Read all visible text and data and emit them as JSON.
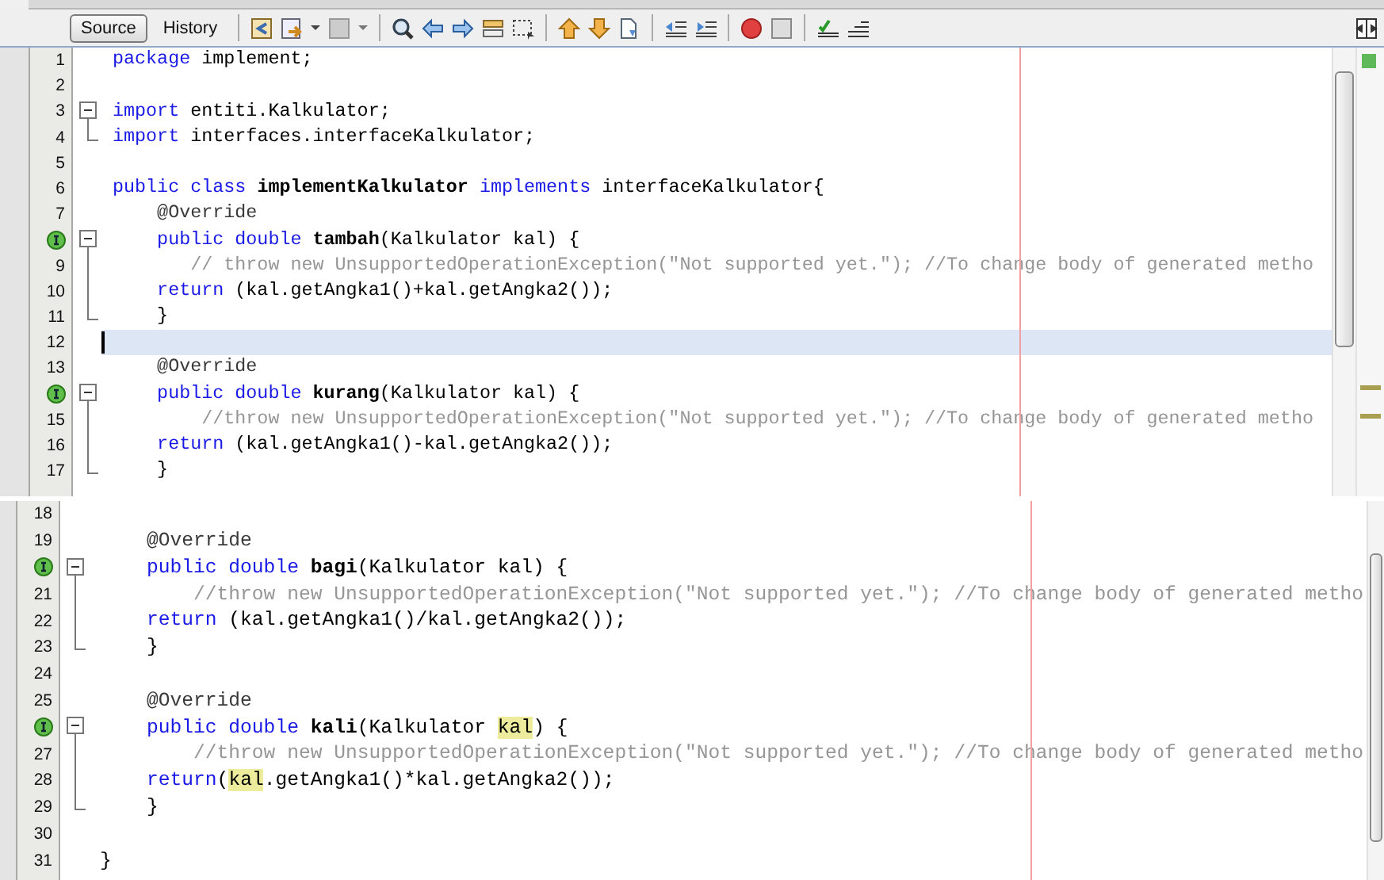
{
  "toolbar": {
    "tabs": [
      {
        "label": "Source",
        "selected": true
      },
      {
        "label": "History",
        "selected": false
      }
    ]
  },
  "editors": [
    {
      "lines": [
        {
          "number": "1",
          "overrides": false,
          "kind": "plain",
          "current": false,
          "tokens": [
            {
              "kind": "keyword",
              "text": "package"
            },
            {
              "kind": "plain",
              "text": " implement;"
            }
          ]
        },
        {
          "number": "2",
          "overrides": false,
          "kind": "plain",
          "current": false
        },
        {
          "number": "3",
          "overrides": false,
          "kind": "open",
          "current": false,
          "tokens": [
            {
              "kind": "keyword",
              "text": "import"
            },
            {
              "kind": "plain",
              "text": " entiti.Kalkulator;"
            }
          ]
        },
        {
          "number": "4",
          "overrides": false,
          "kind": "close",
          "current": false,
          "tokens": [
            {
              "kind": "keyword",
              "text": "import"
            },
            {
              "kind": "plain",
              "text": " interfaces.interfaceKalkulator;"
            }
          ]
        },
        {
          "number": "5",
          "overrides": false,
          "kind": "plain",
          "current": false
        },
        {
          "number": "6",
          "overrides": false,
          "kind": "plain",
          "current": false,
          "tokens": [
            {
              "kind": "keyword",
              "text": "public class "
            },
            {
              "kind": "bold",
              "text": "implementKalkulator"
            },
            {
              "kind": "keyword",
              "text": " implements"
            },
            {
              "kind": "plain",
              "text": " interfaceKalkulator{"
            }
          ]
        },
        {
          "number": "7",
          "overrides": false,
          "kind": "plain",
          "current": false,
          "tokens": [
            {
              "kind": "annotation",
              "text": "    @Override"
            }
          ]
        },
        {
          "overrides": true,
          "kind": "open",
          "current": false,
          "tokens": [
            {
              "kind": "keyword",
              "text": "    public double "
            },
            {
              "kind": "bold",
              "text": "tambah"
            },
            {
              "kind": "plain",
              "text": "(Kalkulator kal) {"
            }
          ]
        },
        {
          "number": "9",
          "overrides": false,
          "kind": "body",
          "current": false,
          "tokens": [
            {
              "kind": "comment",
              "text": "       // throw new UnsupportedOperationException(\"Not supported yet.\"); //To change body of generated metho"
            }
          ]
        },
        {
          "number": "10",
          "overrides": false,
          "kind": "body",
          "current": false,
          "tokens": [
            {
              "kind": "keyword",
              "text": "    return"
            },
            {
              "kind": "plain",
              "text": " (kal.getAngka1()+kal.getAngka2());"
            }
          ]
        },
        {
          "number": "11",
          "overrides": false,
          "kind": "close",
          "current": false,
          "tokens": [
            {
              "kind": "plain",
              "text": "    }"
            }
          ]
        },
        {
          "number": "12",
          "overrides": false,
          "kind": "plain",
          "current": true
        },
        {
          "number": "13",
          "overrides": false,
          "kind": "plain",
          "current": false,
          "tokens": [
            {
              "kind": "annotation",
              "text": "    @Override"
            }
          ]
        },
        {
          "overrides": true,
          "kind": "open",
          "current": false,
          "tokens": [
            {
              "kind": "keyword",
              "text": "    public double "
            },
            {
              "kind": "bold",
              "text": "kurang"
            },
            {
              "kind": "plain",
              "text": "(Kalkulator kal) {"
            }
          ]
        },
        {
          "number": "15",
          "overrides": false,
          "kind": "body",
          "current": false,
          "tokens": [
            {
              "kind": "comment",
              "text": "        //throw new UnsupportedOperationException(\"Not supported yet.\"); //To change body of generated metho"
            }
          ]
        },
        {
          "number": "16",
          "overrides": false,
          "kind": "body",
          "current": false,
          "tokens": [
            {
              "kind": "keyword",
              "text": "    return"
            },
            {
              "kind": "plain",
              "text": " (kal.getAngka1()-kal.getAngka2());"
            }
          ]
        },
        {
          "number": "17",
          "overrides": false,
          "kind": "close",
          "current": false,
          "tokens": [
            {
              "kind": "plain",
              "text": "    }"
            }
          ]
        }
      ]
    },
    {
      "lines": [
        {
          "number": "18",
          "overrides": false,
          "kind": "plain",
          "current": false
        },
        {
          "number": "19",
          "overrides": false,
          "kind": "plain",
          "current": false,
          "tokens": [
            {
              "kind": "annotation",
              "text": "    @Override"
            }
          ]
        },
        {
          "overrides": true,
          "kind": "open",
          "current": false,
          "tokens": [
            {
              "kind": "keyword",
              "text": "    public double "
            },
            {
              "kind": "bold",
              "text": "bagi"
            },
            {
              "kind": "plain",
              "text": "(Kalkulator kal) {"
            }
          ]
        },
        {
          "number": "21",
          "overrides": false,
          "kind": "body",
          "current": false,
          "tokens": [
            {
              "kind": "comment",
              "text": "        //throw new UnsupportedOperationException(\"Not supported yet.\"); //To change body of generated metho"
            }
          ]
        },
        {
          "number": "22",
          "overrides": false,
          "kind": "body",
          "current": false,
          "tokens": [
            {
              "kind": "keyword",
              "text": "    return"
            },
            {
              "kind": "plain",
              "text": " (kal.getAngka1()/kal.getAngka2());"
            }
          ]
        },
        {
          "number": "23",
          "overrides": false,
          "kind": "close",
          "current": false,
          "tokens": [
            {
              "kind": "plain",
              "text": "    }"
            }
          ]
        },
        {
          "number": "24",
          "overrides": false,
          "kind": "plain",
          "current": false
        },
        {
          "number": "25",
          "overrides": false,
          "kind": "plain",
          "current": false,
          "tokens": [
            {
              "kind": "annotation",
              "text": "    @Override"
            }
          ]
        },
        {
          "overrides": true,
          "kind": "open",
          "current": false,
          "tokens": [
            {
              "kind": "keyword",
              "text": "    public double "
            },
            {
              "kind": "bold",
              "text": "kali"
            },
            {
              "kind": "plain",
              "text": "(Kalkulator "
            },
            {
              "kind": "mark",
              "text": "kal"
            },
            {
              "kind": "plain",
              "text": ") {"
            }
          ]
        },
        {
          "number": "27",
          "overrides": false,
          "kind": "body",
          "current": false,
          "tokens": [
            {
              "kind": "comment",
              "text": "        //throw new UnsupportedOperationException(\"Not supported yet.\"); //To change body of generated metho"
            }
          ]
        },
        {
          "number": "28",
          "overrides": false,
          "kind": "body",
          "current": false,
          "tokens": [
            {
              "kind": "keyword",
              "text": "    return"
            },
            {
              "kind": "plain",
              "text": "("
            },
            {
              "kind": "mark",
              "text": "kal"
            },
            {
              "kind": "plain",
              "text": ".getAngka1()*kal.getAngka2());"
            }
          ]
        },
        {
          "number": "29",
          "overrides": false,
          "kind": "close",
          "current": false,
          "tokens": [
            {
              "kind": "plain",
              "text": "    }"
            }
          ]
        },
        {
          "number": "30",
          "overrides": false,
          "kind": "plain",
          "current": false
        },
        {
          "number": "31",
          "overrides": false,
          "kind": "plain",
          "current": false,
          "tokens": [
            {
              "kind": "plain",
              "text": "}"
            }
          ]
        }
      ]
    }
  ]
}
